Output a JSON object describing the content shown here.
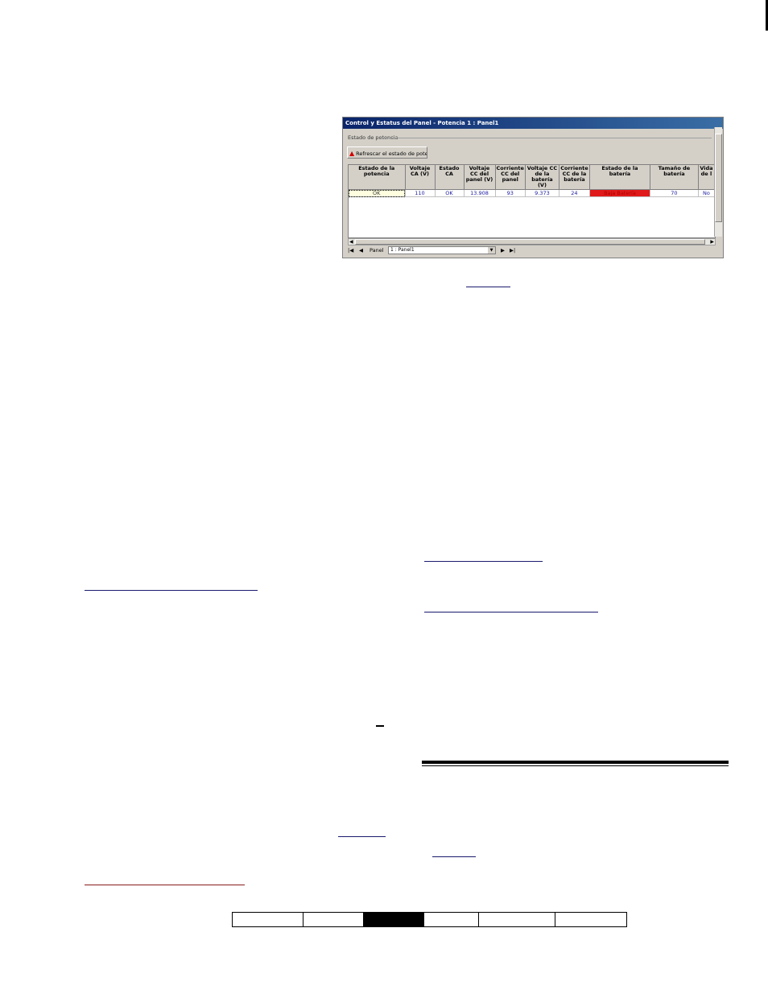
{
  "window": {
    "title": "Control y Estatus del Panel - Potencia 1 : Panel1",
    "group_label": "Estado de potencia",
    "refresh_button": "Refrescar el estado de potencia",
    "columns": [
      "Estado de la potencia",
      "Voltaje CA (V)",
      "Estado CA",
      "Voltaje CC del panel (V)",
      "Corriente CC del panel",
      "Voltaje CC de la batería (V)",
      "Corriente CC de la batería",
      "Estado de la batería",
      "Tamaño de batería",
      "Vida de l"
    ],
    "row": [
      "OK",
      "110",
      "OK",
      "13.908",
      "93",
      "9.373",
      "24",
      "Baja Batería",
      "70",
      "No"
    ],
    "nav": {
      "label": "Panel",
      "selected": "1 : Panel1"
    }
  },
  "colors": {
    "titlebar": "#0a246a",
    "alarm": "#e01a1a",
    "link": "#1a1a6e"
  }
}
